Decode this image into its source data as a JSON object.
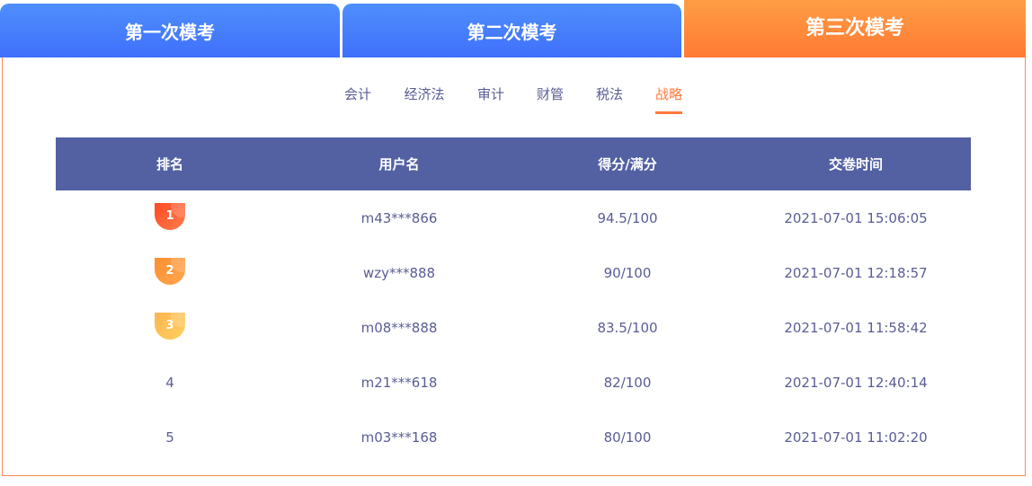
{
  "exam_tabs": [
    {
      "label": "第一次模考"
    },
    {
      "label": "第二次模考"
    },
    {
      "label": "第三次模考"
    }
  ],
  "active_exam_tab": 2,
  "subject_tabs": [
    {
      "label": "会计"
    },
    {
      "label": "经济法"
    },
    {
      "label": "审计"
    },
    {
      "label": "财管"
    },
    {
      "label": "税法"
    },
    {
      "label": "战略"
    }
  ],
  "active_subject": "战略",
  "table": {
    "headers": [
      "排名",
      "用户名",
      "得分/满分",
      "交卷时间"
    ],
    "rows": [
      {
        "rank": "1",
        "user": "m43***866",
        "score": "94.5/100",
        "time": "2021-07-01 15:06:05"
      },
      {
        "rank": "2",
        "user": "wzy***888",
        "score": "90/100",
        "time": "2021-07-01 12:18:57"
      },
      {
        "rank": "3",
        "user": "m08***888",
        "score": "83.5/100",
        "time": "2021-07-01 11:58:42"
      },
      {
        "rank": "4",
        "user": "m21***618",
        "score": "82/100",
        "time": "2021-07-01 12:40:14"
      },
      {
        "rank": "5",
        "user": "m03***168",
        "score": "80/100",
        "time": "2021-07-01 11:02:20"
      }
    ]
  },
  "colors": {
    "medal1": "#ff5a2e",
    "medal2": "#ff9a3a",
    "medal3": "#ffc25a",
    "header": "#5361a3",
    "accent": "#ff7a3c"
  }
}
